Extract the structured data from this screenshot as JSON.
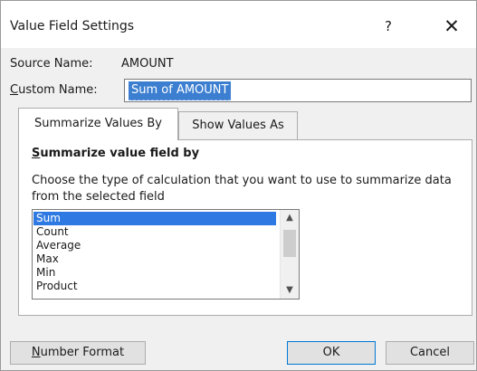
{
  "dialog": {
    "title": "Value Field Settings",
    "help_glyph": "?",
    "close_glyph": "✕"
  },
  "source": {
    "label": "Source Name:",
    "value": "AMOUNT"
  },
  "custom_name": {
    "label_first": "C",
    "label_rest": "ustom Name:",
    "value": "Sum of AMOUNT"
  },
  "tabs": [
    {
      "label": "Summarize Values By",
      "active": true
    },
    {
      "label": "Show Values As",
      "active": false
    }
  ],
  "panel": {
    "heading_first": "S",
    "heading_rest": "ummarize value field by",
    "description": "Choose the type of calculation that you want to use to summarize data from the selected field"
  },
  "functions": {
    "items": [
      "Sum",
      "Count",
      "Average",
      "Max",
      "Min",
      "Product"
    ],
    "selected": "Sum"
  },
  "scrollbar": {
    "up_glyph": "▲",
    "down_glyph": "▼"
  },
  "buttons": {
    "number_format_first": "N",
    "number_format_rest": "umber Format",
    "ok": "OK",
    "cancel": "Cancel"
  },
  "colors": {
    "selection": "#2f7ae2",
    "dialog_bg": "#f0f0f0",
    "focus_border": "#0078d7"
  }
}
